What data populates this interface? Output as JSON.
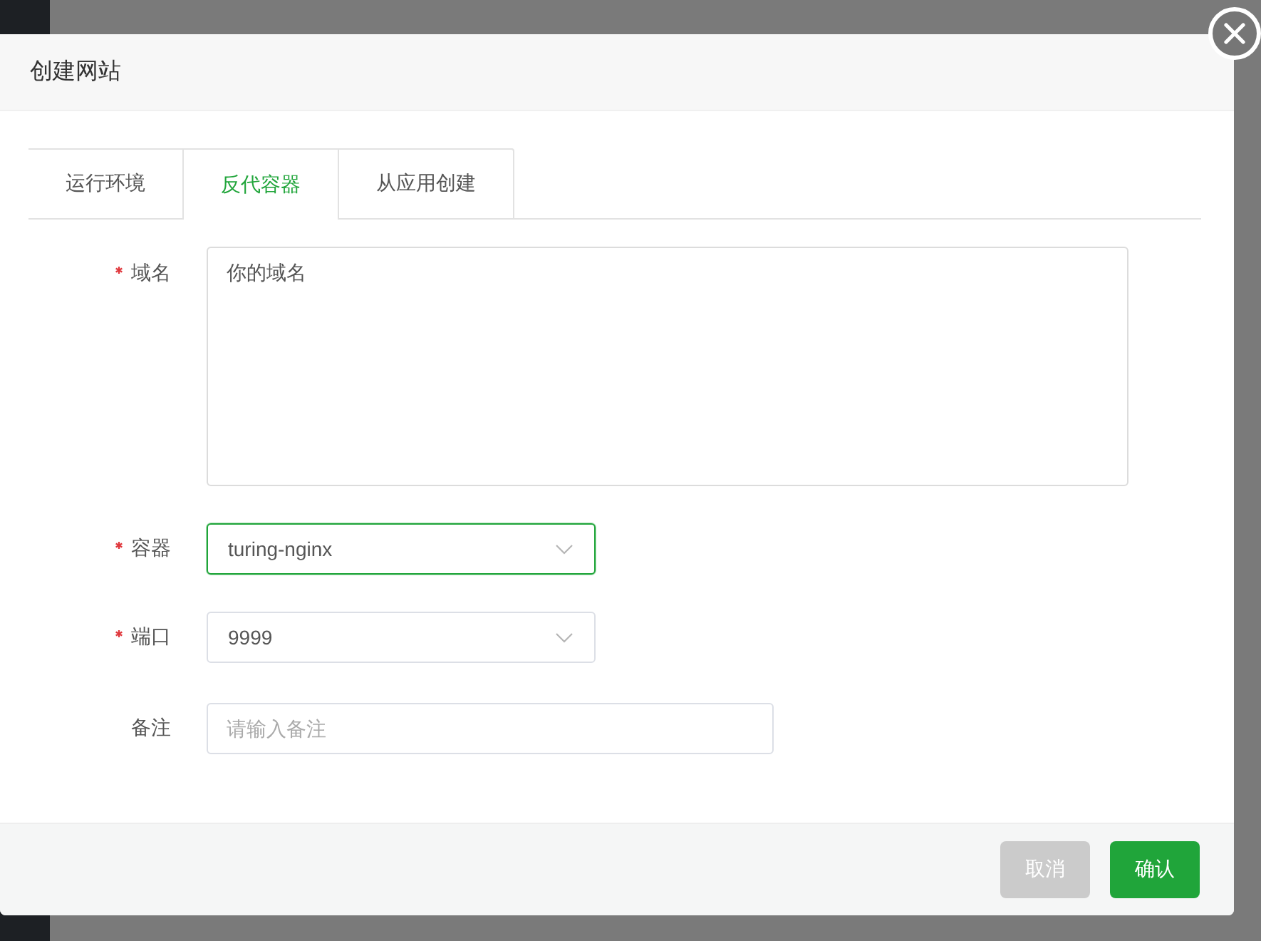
{
  "dialog": {
    "title": "创建网站"
  },
  "tabs": [
    {
      "label": "运行环境",
      "selected": false
    },
    {
      "label": "反代容器",
      "selected": true
    },
    {
      "label": "从应用创建",
      "selected": false
    }
  ],
  "form": {
    "fields": [
      {
        "kind": "textarea",
        "label": "域名",
        "required": true,
        "value": "你的域名"
      },
      {
        "kind": "select",
        "label": "容器",
        "required": true,
        "value": "turing-nginx",
        "focused": true
      },
      {
        "kind": "select",
        "label": "端口",
        "required": true,
        "value": "9999",
        "focused": false
      },
      {
        "kind": "input",
        "label": "备注",
        "required": false,
        "placeholder": "请输入备注"
      }
    ]
  },
  "buttons": [
    {
      "kind": "cancel",
      "label": "取消"
    },
    {
      "kind": "confirm",
      "label": "确认"
    }
  ]
}
